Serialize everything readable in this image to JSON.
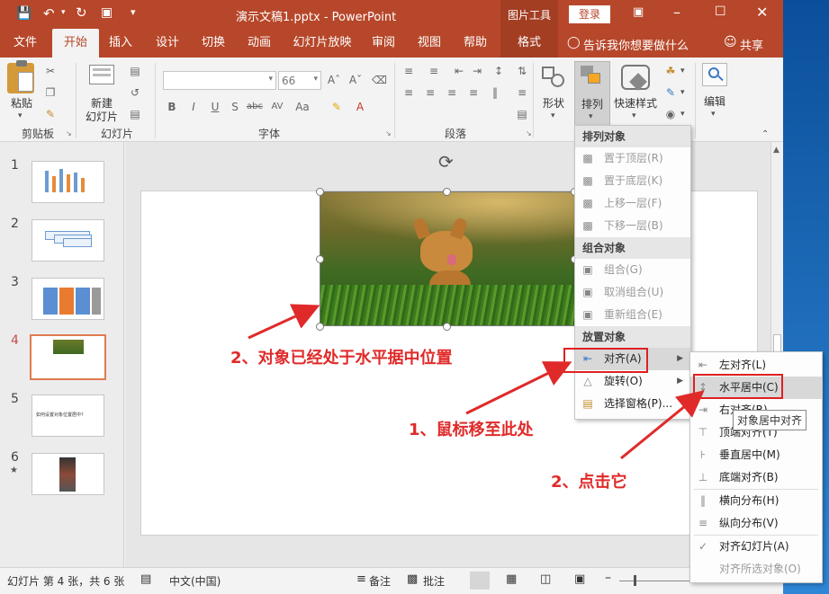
{
  "window": {
    "title": "演示文稿1.pptx  -  PowerPoint",
    "context_tab": "图片工具",
    "login_label": "登录"
  },
  "tabs": [
    "文件",
    "开始",
    "插入",
    "设计",
    "切换",
    "动画",
    "幻灯片放映",
    "审阅",
    "视图",
    "帮助",
    "格式"
  ],
  "tell_me": "告诉我你想要做什么",
  "share": "共享",
  "ribbon": {
    "paste": "粘贴",
    "clipboard": "剪贴板",
    "new_slide_line1": "新建",
    "new_slide_line2": "幻灯片",
    "slides_group": "幻灯片",
    "font_size": "66",
    "font_group": "字体",
    "paragraph_group": "段落",
    "shape": "形状",
    "arrange": "排列",
    "quick_styles": "快速样式",
    "edit": "编辑",
    "font_buttons": [
      "B",
      "I",
      "U",
      "S",
      "abc",
      "AV",
      "Aa"
    ]
  },
  "thumbnails": [
    {
      "num": "1",
      "star": ""
    },
    {
      "num": "2",
      "star": ""
    },
    {
      "num": "3",
      "star": ""
    },
    {
      "num": "4",
      "star": ""
    },
    {
      "num": "5",
      "star": "",
      "text": "如何设置对象位置居中?"
    },
    {
      "num": "6",
      "star": "★"
    }
  ],
  "arrange_menu": {
    "section1": "排列对象",
    "items1": [
      "置于顶层(R)",
      "置于底层(K)",
      "上移一层(F)",
      "下移一层(B)"
    ],
    "section2": "组合对象",
    "items2": [
      "组合(G)",
      "取消组合(U)",
      "重新组合(E)"
    ],
    "section3": "放置对象",
    "align": "对齐(A)",
    "rotate": "旋转(O)",
    "selection_pane": "选择窗格(P)..."
  },
  "align_menu": {
    "items": [
      "左对齐(L)",
      "水平居中(C)",
      "右对齐(R)",
      "顶端对齐(T)",
      "垂直居中(M)",
      "底端对齐(B)",
      "横向分布(H)",
      "纵向分布(V)",
      "对齐幻灯片(A)",
      "对齐所选对象(O)"
    ],
    "tooltip": "对象居中对齐"
  },
  "annotations": {
    "a1": "2、对象已经处于水平据中位置",
    "a2": "1、鼠标移至此处",
    "a3": "2、点击它",
    "accent": "#e02a2a"
  },
  "status": {
    "slide_info": "幻灯片 第 4 张，共 6 张",
    "language": "中文(中国)",
    "notes": "备注",
    "comments": "批注"
  },
  "colors": {
    "brand": "#b7472a"
  }
}
